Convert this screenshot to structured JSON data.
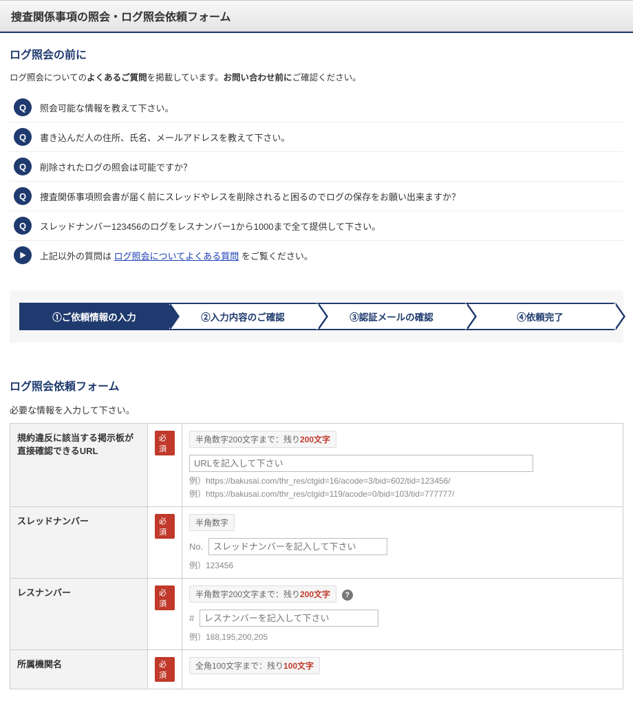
{
  "page_title": "捜査関係事項の照会・ログ照会依頼フォーム",
  "before_section": {
    "heading": "ログ照会の前に",
    "intro_prefix": "ログ照会についての",
    "intro_bold1": "よくあるご質問",
    "intro_mid": "を掲載しています。",
    "intro_bold2": "お問い合わせ前に",
    "intro_suffix": "ご確認ください。",
    "q_label": "Q",
    "items": [
      "照会可能な情報を教えて下さい。",
      "書き込んだ人の住所、氏名、メールアドレスを教えて下さい。",
      "削除されたログの照会は可能ですか？",
      "捜査関係事項照会書が届く前にスレッドやレスを削除されると困るのでログの保存をお願い出来ますか？",
      "スレッドナンバー123456のログをレスナンバー1から1000まで全て提供して下さい。"
    ],
    "more_prefix": "上記以外の質問は ",
    "more_link": "ログ照会についてよくある質問",
    "more_suffix": " をご覧ください。"
  },
  "steps": [
    "①ご依頼情報の入力",
    "②入力内容のご確認",
    "③認証メールの確認",
    "④依頼完了"
  ],
  "form": {
    "heading": "ログ照会依頼フォーム",
    "instruction": "必要な情報を入力して下さい。",
    "required_label": "必須",
    "rows": {
      "url": {
        "label": "規約違反に該当する掲示板が直接確認できるURL",
        "hint_prefix": "半角数字200文字まで：残り",
        "hint_count": "200文字",
        "placeholder": "URLを記入して下さい",
        "example1": "例）https://bakusai.com/thr_res/ctgid=16/acode=3/bid=602/tid=123456/",
        "example2": "例）https://bakusai.com/thr_res/ctgid=119/acode=0/bid=103/tid=777777/"
      },
      "thread": {
        "label": "スレッドナンバー",
        "hint": "半角数字",
        "prefix": "No.",
        "placeholder": "スレッドナンバーを記入して下さい",
        "example": "例）123456"
      },
      "res": {
        "label": "レスナンバー",
        "hint_prefix": "半角数字200文字まで：残り",
        "hint_count": "200文字",
        "prefix": "#",
        "placeholder": "レスナンバーを記入して下さい",
        "example": "例）188,195,200,205",
        "help": "?"
      },
      "org": {
        "label": "所属機関名",
        "hint_prefix": "全角100文字まで：残り",
        "hint_count": "100文字"
      }
    }
  }
}
